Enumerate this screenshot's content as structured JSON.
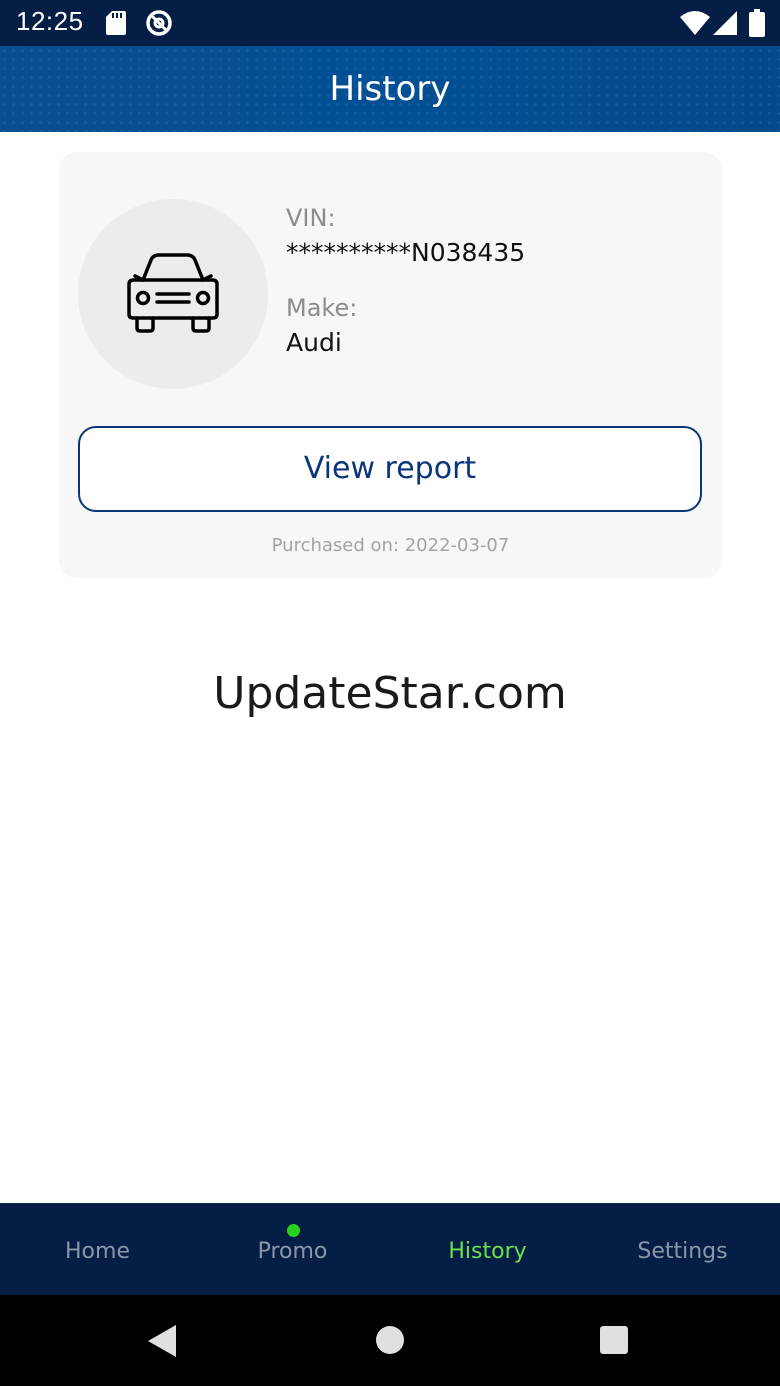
{
  "status_bar": {
    "time": "12:25",
    "icons": [
      "sd-card-icon",
      "no-disturb-icon",
      "wifi-icon",
      "signal-icon",
      "battery-icon"
    ]
  },
  "app_bar": {
    "title": "History"
  },
  "card": {
    "vin_label": "VIN:",
    "vin_value": "**********N038435",
    "make_label": "Make:",
    "make_value": "Audi",
    "view_report_label": "View report",
    "purchased_text": "Purchased on: 2022-03-07",
    "icon": "car-icon"
  },
  "watermark": "UpdateStar.com",
  "bottom_nav": {
    "items": [
      {
        "label": "Home"
      },
      {
        "label": "Promo"
      },
      {
        "label": "History"
      },
      {
        "label": "Settings"
      }
    ],
    "active_index": 2
  },
  "colors": {
    "app_bar": "#034f93",
    "status_bar": "#041e45",
    "nav_bar": "#041e45",
    "accent_active": "#6be04c",
    "promo_dot": "#29d11b",
    "button_border": "#0a3578"
  }
}
